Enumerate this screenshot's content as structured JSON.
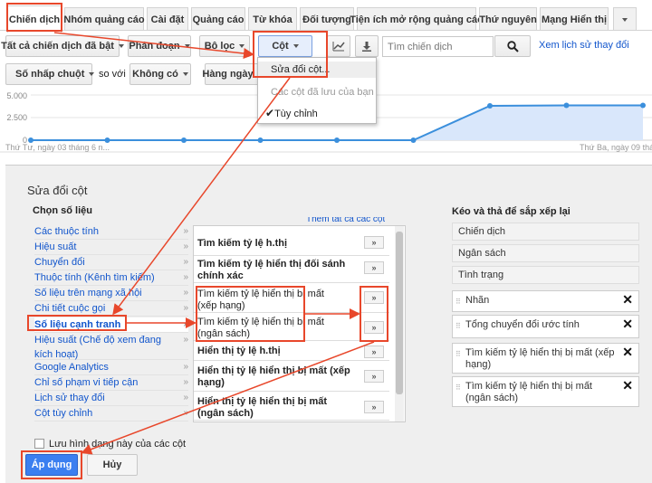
{
  "tabs": [
    "Chiến dịch",
    "Nhóm quảng cáo",
    "Cài đặt",
    "Quảng cáo",
    "Từ khóa",
    "Đối tượng",
    "Tiện ích mở rộng quảng cáo",
    "Thứ nguyên",
    "Mạng Hiển thị"
  ],
  "toolbar": {
    "campaigns_filter": "Tất cả chiến dịch đã bật",
    "segment": "Phân đoạn",
    "filter": "Bộ lọc",
    "columns": "Cột",
    "search_placeholder": "Tìm chiến dịch",
    "history_link": "Xem lịch sử thay đổi",
    "metric1": "Số nhấp chuột",
    "compare": "so với",
    "metric2": "Không có",
    "period": "Hàng ngày"
  },
  "columns_menu": {
    "edit": "Sửa đổi cột...",
    "saved_header": "Các cột đã lưu của bạn",
    "custom": "Tùy chỉnh"
  },
  "graph": {
    "y_ticks": [
      "5.000",
      "2.500",
      "0"
    ],
    "start_label": "Thứ Tư, ngày 03 tháng 6 n...",
    "end_label": "Thứ Ba, ngày 09 thán",
    "chart_data": {
      "type": "area",
      "series": [
        {
          "values": [
            0,
            0,
            0,
            0,
            0,
            0,
            3800,
            3850,
            3850
          ]
        }
      ],
      "ylim": [
        0,
        5000
      ],
      "grid": true
    }
  },
  "editor": {
    "title": "Sửa đổi cột",
    "choose_metric": "Chọn số liệu",
    "add_all_link": "Thêm tất cả các cột",
    "categories": [
      "Các thuộc tính",
      "Hiệu suất",
      "Chuyển đổi",
      "Thuộc tính (Kênh tìm kiếm)",
      "Số liệu trên mạng xã hội",
      "Chi tiết cuộc gọi",
      "Số liệu cạnh tranh",
      "Hiệu suất (Chế độ xem đang kích hoạt)",
      "Google Analytics",
      "Chỉ số phạm vi tiếp cận",
      "Lịch sử thay đổi",
      "Cột tùy chỉnh"
    ],
    "metrics": [
      "Tìm kiếm tỷ lệ h.thị",
      "Tìm kiếm tỷ lệ hiển thị đối sánh chính xác",
      "Tìm kiếm tỷ lệ hiển thị bị mất (xếp hạng)",
      "Tìm kiếm tỷ lệ hiển thị bị mất (ngân sách)",
      "Hiển thị tỷ lệ h.thị",
      "Hiển thị tỷ lệ hiển thị bị mất (xếp hạng)",
      "Hiển thị tỷ lệ hiển thị bị mất (ngân sách)"
    ],
    "add_symbol": "»",
    "reorder_title": "Kéo và thả để sắp xếp lại",
    "fixed_columns": [
      "Chiến dịch",
      "Ngân sách",
      "Tình trạng"
    ],
    "selected_columns": [
      "Nhãn",
      "Tổng chuyển đổi ước tính",
      "Tìm kiếm tỷ lệ hiển thị bị mất (xếp hạng)",
      "Tìm kiếm tỷ lệ hiển thị bị mất (ngân sách)"
    ],
    "remove_symbol": "✕",
    "save_checkbox": "Lưu hình dạng này của các cột",
    "apply": "Áp dụng",
    "cancel": "Hủy"
  },
  "colors": {
    "accent": "#4d90fe",
    "link": "#1155cc",
    "highlight": "#e8472b",
    "apply": "#3b7ff0"
  }
}
